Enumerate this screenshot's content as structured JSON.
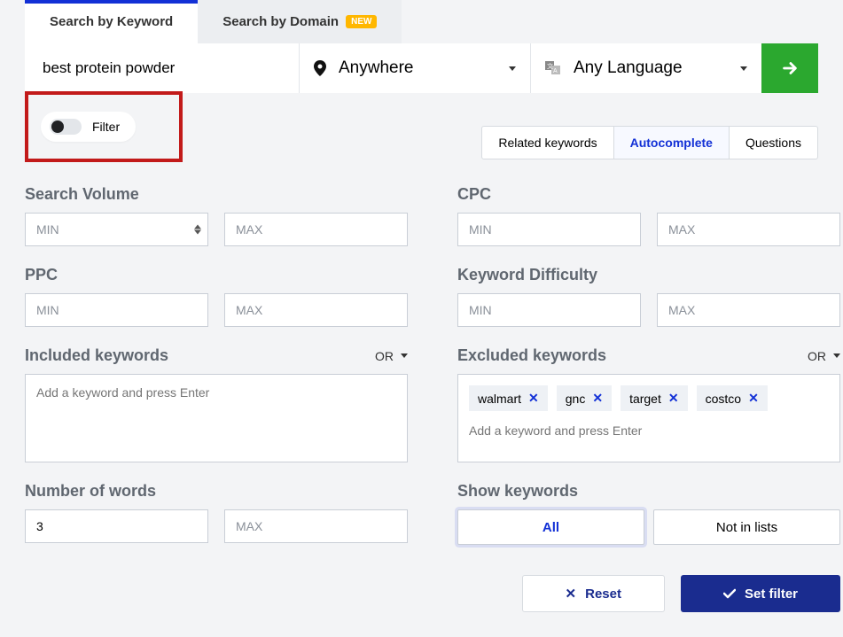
{
  "tabs": {
    "search_keyword": "Search by Keyword",
    "search_domain": "Search by Domain",
    "new_badge": "NEW"
  },
  "search": {
    "query": "best protein powder",
    "location": "Anywhere",
    "language": "Any Language"
  },
  "filter_toggle_label": "Filter",
  "result_tabs": {
    "related": "Related keywords",
    "autocomplete": "Autocomplete",
    "questions": "Questions"
  },
  "labels": {
    "search_volume": "Search Volume",
    "cpc": "CPC",
    "ppc": "PPC",
    "kd": "Keyword Difficulty",
    "included": "Included keywords",
    "excluded": "Excluded keywords",
    "num_words": "Number of words",
    "show_kw": "Show keywords",
    "or": "OR"
  },
  "placeholders": {
    "min": "MIN",
    "max": "MAX",
    "add_keyword": "Add a keyword and press Enter"
  },
  "values": {
    "num_words_min": "3"
  },
  "excluded_tags": [
    "walmart",
    "gnc",
    "target",
    "costco"
  ],
  "show_keywords": {
    "all": "All",
    "not_in_lists": "Not in lists"
  },
  "buttons": {
    "reset": "Reset",
    "set_filter": "Set filter"
  }
}
